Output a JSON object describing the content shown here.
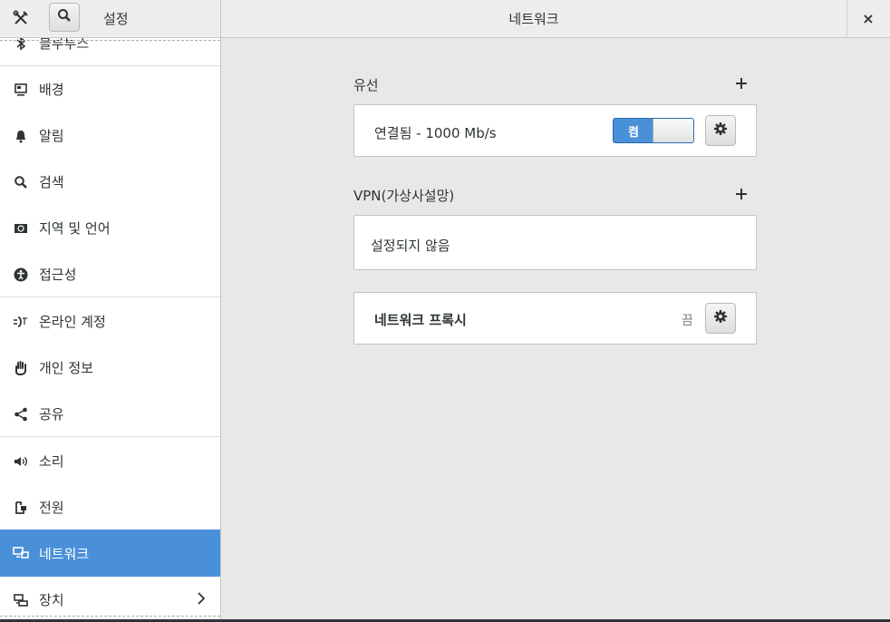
{
  "header": {
    "sidebar_title": "설정",
    "title": "네트워크",
    "close_label": "×"
  },
  "sidebar": {
    "items": [
      {
        "label": "블루투스",
        "icon": "bluetooth-icon"
      },
      {
        "label": "배경",
        "icon": "background-icon"
      },
      {
        "label": "알림",
        "icon": "bell-icon"
      },
      {
        "label": "검색",
        "icon": "search-icon"
      },
      {
        "label": "지역 및 언어",
        "icon": "region-icon"
      },
      {
        "label": "접근성",
        "icon": "accessibility-icon"
      },
      {
        "label": "온라인 계정",
        "icon": "online-accounts-icon"
      },
      {
        "label": "개인 정보",
        "icon": "privacy-hand-icon"
      },
      {
        "label": "공유",
        "icon": "share-icon"
      },
      {
        "label": "소리",
        "icon": "speaker-icon"
      },
      {
        "label": "전원",
        "icon": "power-icon"
      },
      {
        "label": "네트워크",
        "icon": "network-icon",
        "active": true
      },
      {
        "label": "장치",
        "icon": "devices-icon"
      }
    ]
  },
  "wired": {
    "title": "유선",
    "status": "연결됨 - 1000 Mb/s",
    "switch_on_label": "켬",
    "switch_state": "on"
  },
  "vpn": {
    "title": "VPN(가상사설망)",
    "empty_text": "설정되지 않음"
  },
  "proxy": {
    "label": "네트워크 프록시",
    "status": "끔"
  },
  "colors": {
    "accent": "#4a90d9",
    "window_bg": "#e8e8e7",
    "sidebar_bg": "#ffffff"
  }
}
